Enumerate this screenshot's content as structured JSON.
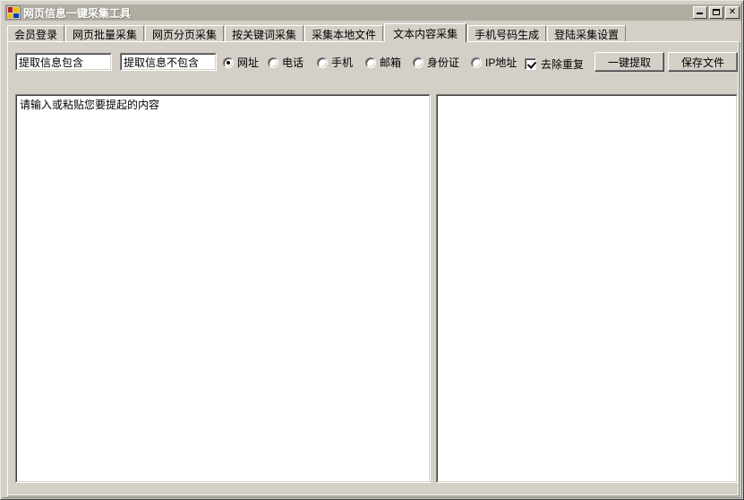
{
  "window": {
    "title": "网页信息一键采集工具",
    "icon": "app-icon",
    "controls": {
      "minimize": "_",
      "maximize": "□",
      "close": "✕"
    }
  },
  "tabs": [
    {
      "label": "会员登录",
      "active": false
    },
    {
      "label": "网页批量采集",
      "active": false
    },
    {
      "label": "网页分页采集",
      "active": false
    },
    {
      "label": "按关键词采集",
      "active": false
    },
    {
      "label": "采集本地文件",
      "active": false
    },
    {
      "label": "文本内容采集",
      "active": true
    },
    {
      "label": "手机号码生成",
      "active": false
    },
    {
      "label": "登陆采集设置",
      "active": false
    }
  ],
  "toolbar": {
    "include_field": {
      "value": "提取信息包含",
      "placeholder": "提取信息包含"
    },
    "exclude_field": {
      "value": "提取信息不包含",
      "placeholder": "提取信息不包含"
    },
    "radios": [
      {
        "label": "网址",
        "checked": true
      },
      {
        "label": "电话",
        "checked": false
      },
      {
        "label": "手机",
        "checked": false
      },
      {
        "label": "邮箱",
        "checked": false
      },
      {
        "label": "身份证",
        "checked": false
      },
      {
        "label": "IP地址",
        "checked": false
      }
    ],
    "dedupe_checkbox": {
      "label": "去除重复",
      "checked": true
    },
    "extract_button": "一键提取",
    "save_button": "保存文件"
  },
  "panels": {
    "input": {
      "placeholder": "请输入或粘贴您要提起的内容",
      "value": ""
    },
    "output": {
      "value": ""
    }
  },
  "colors": {
    "face": "#d4d0c8",
    "titlebar": "#b0aca0",
    "title_text": "#ffffff",
    "field_bg": "#ffffff",
    "text": "#000000",
    "shadow": "#808080",
    "dark_shadow": "#404040",
    "highlight": "#ffffff"
  }
}
